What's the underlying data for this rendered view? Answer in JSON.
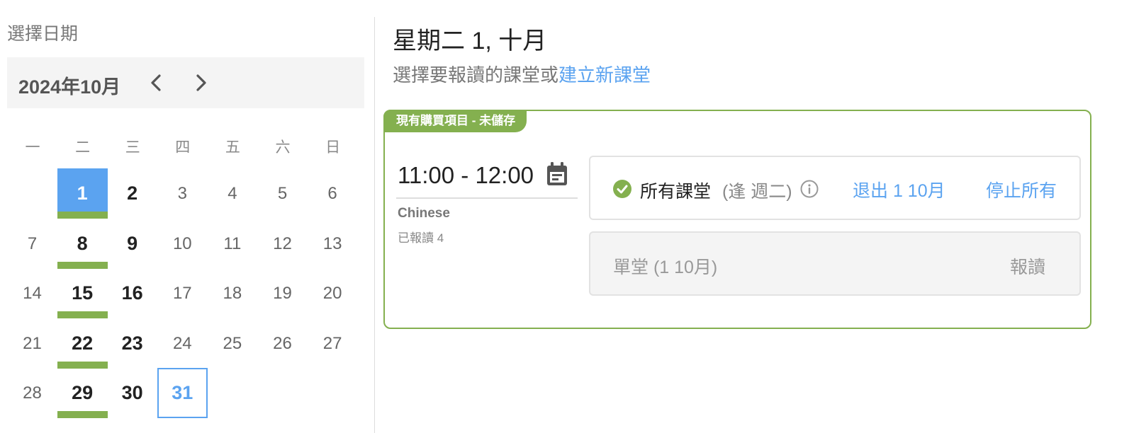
{
  "left_panel": {
    "title": "選擇日期",
    "month_label": "2024年10月",
    "weekdays": [
      "一",
      "二",
      "三",
      "四",
      "五",
      "六",
      "日"
    ],
    "days": [
      "1",
      "2",
      "3",
      "4",
      "5",
      "6",
      "7",
      "8",
      "9",
      "10",
      "11",
      "12",
      "13",
      "14",
      "15",
      "16",
      "17",
      "18",
      "19",
      "20",
      "21",
      "22",
      "23",
      "24",
      "25",
      "26",
      "27",
      "28",
      "29",
      "30",
      "31"
    ],
    "selected_day": "1",
    "today": "31",
    "bold_days": [
      "1",
      "2",
      "8",
      "9",
      "15",
      "16",
      "22",
      "23",
      "29",
      "30"
    ],
    "enrolled_days": [
      "1",
      "8",
      "15",
      "22",
      "29"
    ]
  },
  "main": {
    "date_title": "星期二 1, 十月",
    "subtitle_prefix": "選擇要報讀的課堂或",
    "subtitle_link": "建立新課堂"
  },
  "card": {
    "tag": "現有購買項目 - 未儲存",
    "time": "11:00 - 12:00",
    "course": "Chinese",
    "enrolled": "已報讀 4",
    "option_all": {
      "label": "所有課堂",
      "sublabel": "(逢 週二)",
      "withdraw_link": "退出 1 10月",
      "stop_link": "停止所有"
    },
    "option_single": {
      "label": "單堂 (1 10月)",
      "action": "報讀"
    }
  },
  "colors": {
    "accent_blue": "#5ba3f0",
    "accent_green": "#84b04f",
    "panel_gray": "#f4f4f4"
  },
  "icons": {
    "prev": "chevron-left-icon",
    "next": "chevron-right-icon",
    "calendar": "calendar-icon",
    "check": "check-circle-icon",
    "info": "info-icon"
  }
}
